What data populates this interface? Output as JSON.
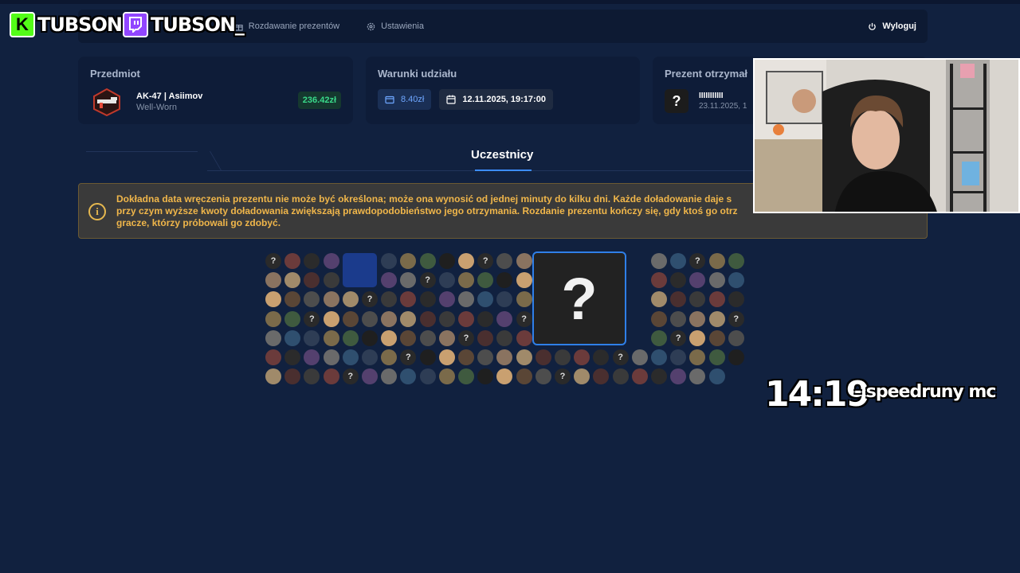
{
  "nav": {
    "items": [
      {
        "label": "Rozdawanie prezentów",
        "icon": "gift-icon"
      },
      {
        "label": "Ustawienia",
        "icon": "gear-icon"
      }
    ],
    "first_partial": "ro",
    "logout_label": "Wyloguj"
  },
  "item_card": {
    "title": "Przedmiot",
    "name": "AK-47 | Asiimov",
    "wear": "Well-Worn",
    "price": "236.42zł"
  },
  "conditions_card": {
    "title": "Warunki udziału",
    "min_deposit": "8.40zł",
    "date": "12.11.2025, 19:17:00"
  },
  "winner_card": {
    "title": "Prezent otrzymał",
    "winner_name": "IIIIIIIIIII",
    "winner_date": "23.11.2025, 1"
  },
  "tabs": {
    "active": "Uczestnicy"
  },
  "alert": {
    "text_line1": "Dokładna data wręczenia prezentu nie może być określona; może ona wynosić od jednej minuty do kilku dni. Każde doładowanie daje s",
    "text_line2": "przy czym wyższe kwoty doładowania zwiększają prawdopodobieństwo jego otrzymania. Rozdanie prezentu kończy się, gdy ktoś go otrz",
    "text_line3": "gracze, którzy próbowali go zdobyć."
  },
  "participants": {
    "placeholder_symbol": "?"
  },
  "overlay": {
    "kick_name": "TUBSON",
    "twitch_name": "TUBSON_",
    "timer": "14:19",
    "timer_label": "- speedruny mc"
  },
  "colors": {
    "background": "#11213f",
    "card": "#0e1c38",
    "accent_blue": "#3c8cff",
    "price_green": "#39d98a",
    "alert_text": "#f0b64a"
  }
}
